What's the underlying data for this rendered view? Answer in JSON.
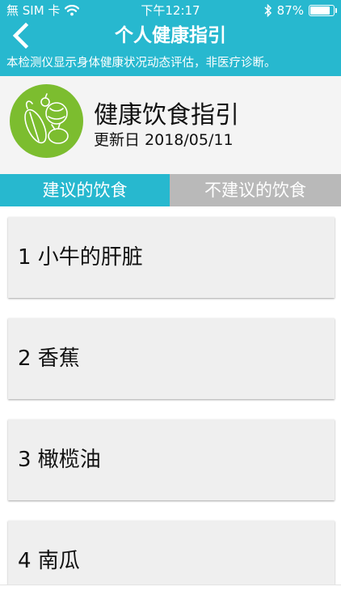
{
  "status_bar": {
    "carrier": "無 SIM 卡",
    "time": "下午12:17",
    "battery": "87%",
    "battery_level": 0.87,
    "icons": [
      "wifi-icon",
      "bluetooth-icon",
      "battery-icon"
    ]
  },
  "header": {
    "title": "个人健康指引",
    "back_icon": "chevron-left-icon",
    "notice": "本检测仪显示身体健康状况动态评估，非医疗诊断。"
  },
  "guide": {
    "title": "健康饮食指引",
    "updated": "更新日 2018/05/11",
    "icon": "vegetables-icon"
  },
  "tabs": {
    "recommended": "建议的饮食",
    "not_recommended": "不建议的饮食"
  },
  "foods": [
    "1 小牛的肝脏",
    "2 香蕉",
    "3 橄榄油",
    "4 南瓜"
  ],
  "colors": {
    "accent": "#27b8cf",
    "tab_inactive": "#b9b9b9",
    "avatar": "#7cbd2f",
    "card_bg": "#efefef"
  }
}
